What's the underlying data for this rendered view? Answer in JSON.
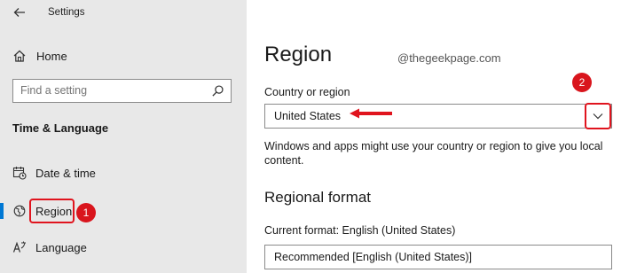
{
  "window": {
    "title": "Settings"
  },
  "sidebar": {
    "home_label": "Home",
    "search_placeholder": "Find a setting",
    "section_title": "Time & Language",
    "items": [
      {
        "label": "Date & time",
        "icon": "calendar-clock-icon"
      },
      {
        "label": "Region",
        "icon": "globe-region-icon",
        "active": true
      },
      {
        "label": "Language",
        "icon": "language-icon"
      }
    ]
  },
  "main": {
    "title": "Region",
    "watermark": "@thegeekpage.com",
    "country_label": "Country or region",
    "country_value": "United States",
    "country_description": "Windows and apps might use your country or region to give you local content.",
    "regional_format_heading": "Regional format",
    "current_format_label": "Current format: English (United States)",
    "format_value": "Recommended [English (United States)]"
  },
  "annotations": {
    "badge_1": "1",
    "badge_2": "2",
    "highlight_color": "#e0141e"
  },
  "colors": {
    "accent": "#0078d4",
    "sidebar_bg": "#e8e8e8"
  }
}
